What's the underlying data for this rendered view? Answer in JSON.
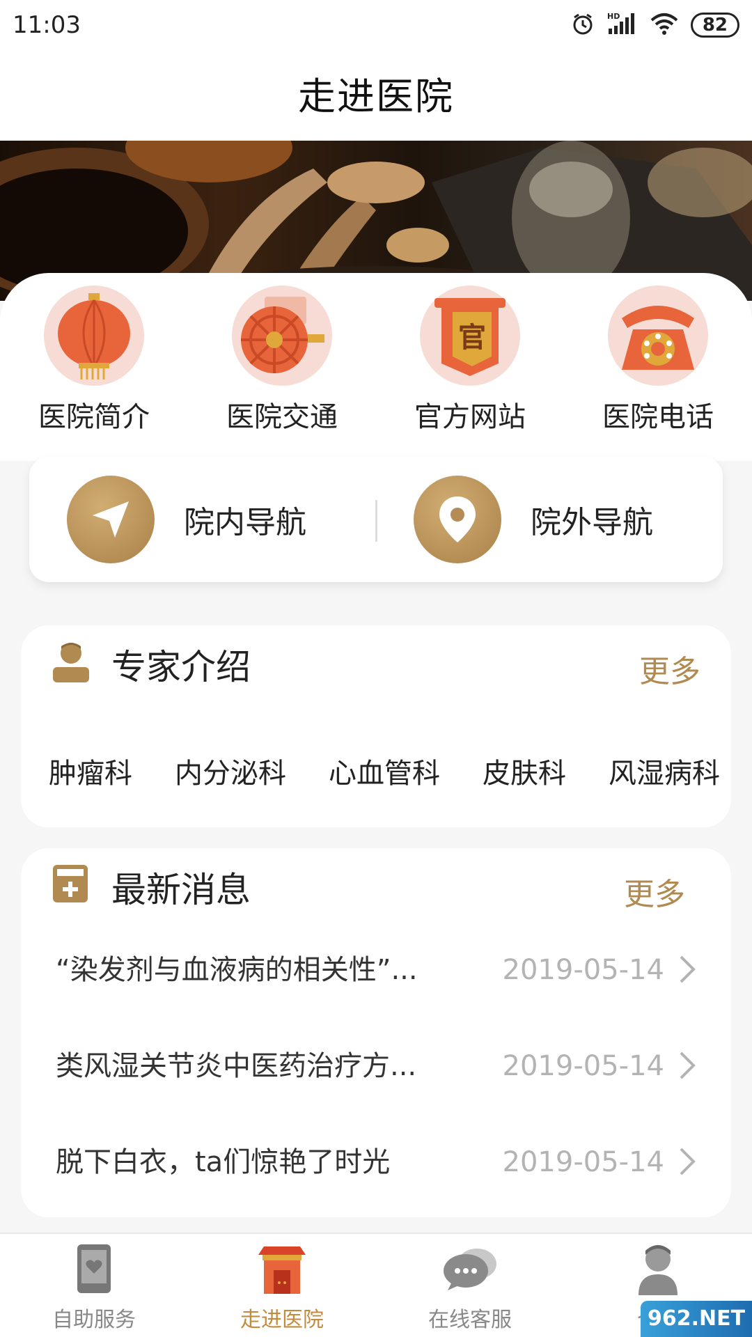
{
  "status_bar": {
    "time": "11:03",
    "network_label": "HD",
    "battery": "82"
  },
  "header": {
    "title": "走进医院"
  },
  "quick_entries": [
    {
      "label": "医院简介",
      "icon": "lantern-icon"
    },
    {
      "label": "医院交通",
      "icon": "carriage-wheel-icon"
    },
    {
      "label": "官方网站",
      "icon": "official-banner-icon"
    },
    {
      "label": "医院电话",
      "icon": "rotary-phone-icon"
    }
  ],
  "official_banner_text": "官",
  "navigation": {
    "inner_label": "院内导航",
    "outer_label": "院外导航"
  },
  "experts": {
    "title": "专家介绍",
    "more_label": "更多",
    "departments": [
      "肿瘤科",
      "内分泌科",
      "心血管科",
      "皮肤科",
      "风湿病科"
    ]
  },
  "news": {
    "title": "最新消息",
    "more_label": "更多",
    "items": [
      {
        "title": "“染发剂与血液病的相关性”...",
        "date": "2019-05-14"
      },
      {
        "title": "类风湿关节炎中医药治疗方...",
        "date": "2019-05-14"
      },
      {
        "title": "脱下白衣，ta们惊艳了时光",
        "date": "2019-05-14"
      }
    ]
  },
  "tab_bar": {
    "active": "走进医院",
    "tabs": [
      {
        "label": "自助服务",
        "icon": "phone-heart-icon"
      },
      {
        "label": "走进医院",
        "icon": "hospital-gate-icon"
      },
      {
        "label": "在线客服",
        "icon": "chat-bubble-icon"
      },
      {
        "label": "个人",
        "icon": "person-icon"
      }
    ]
  },
  "watermark": "962.NET",
  "colors": {
    "accent_gold": "#b08a50",
    "active_tab": "#c38b3e",
    "entry_circle_bg": "#f6dcd4",
    "entry_icon_orange": "#e8643a"
  }
}
